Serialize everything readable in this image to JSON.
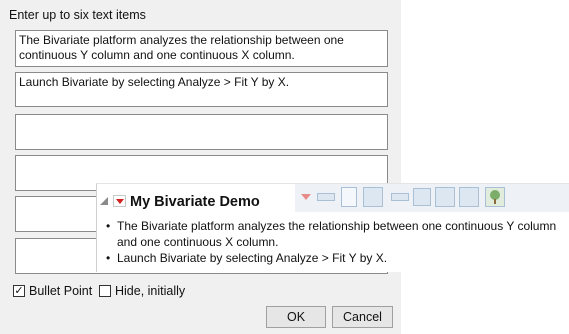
{
  "dialog": {
    "prompt": "Enter up to six text items",
    "items": [
      "The Bivariate platform analyzes the relationship between one\ncontinuous Y column and one continuous X column.",
      "Launch Bivariate by selecting Analyze > Fit Y by X.",
      "",
      "",
      "",
      ""
    ],
    "bullet_point": {
      "label": "Bullet Point",
      "checked": true
    },
    "hide_initially": {
      "label": "Hide, initially",
      "checked": false
    },
    "ok_label": "OK",
    "cancel_label": "Cancel"
  },
  "preview": {
    "title": "My Bivariate Demo",
    "bullets": [
      "The Bivariate platform analyzes the relationship between one continuous Y column and one continuous X column.",
      "Launch Bivariate by selecting Analyze > Fit Y by X."
    ],
    "toolbar_icons": [
      "red-triangle-icon",
      "line-icon",
      "text-icon",
      "outline-box-icon",
      "line-icon",
      "table-icon",
      "panel-icon",
      "panel-icon",
      "tree-icon"
    ]
  },
  "colors": {
    "accent_red": "#d21f1f",
    "dialog_bg": "#f0f0f0",
    "toolbar_bg": "#eef2f7"
  }
}
